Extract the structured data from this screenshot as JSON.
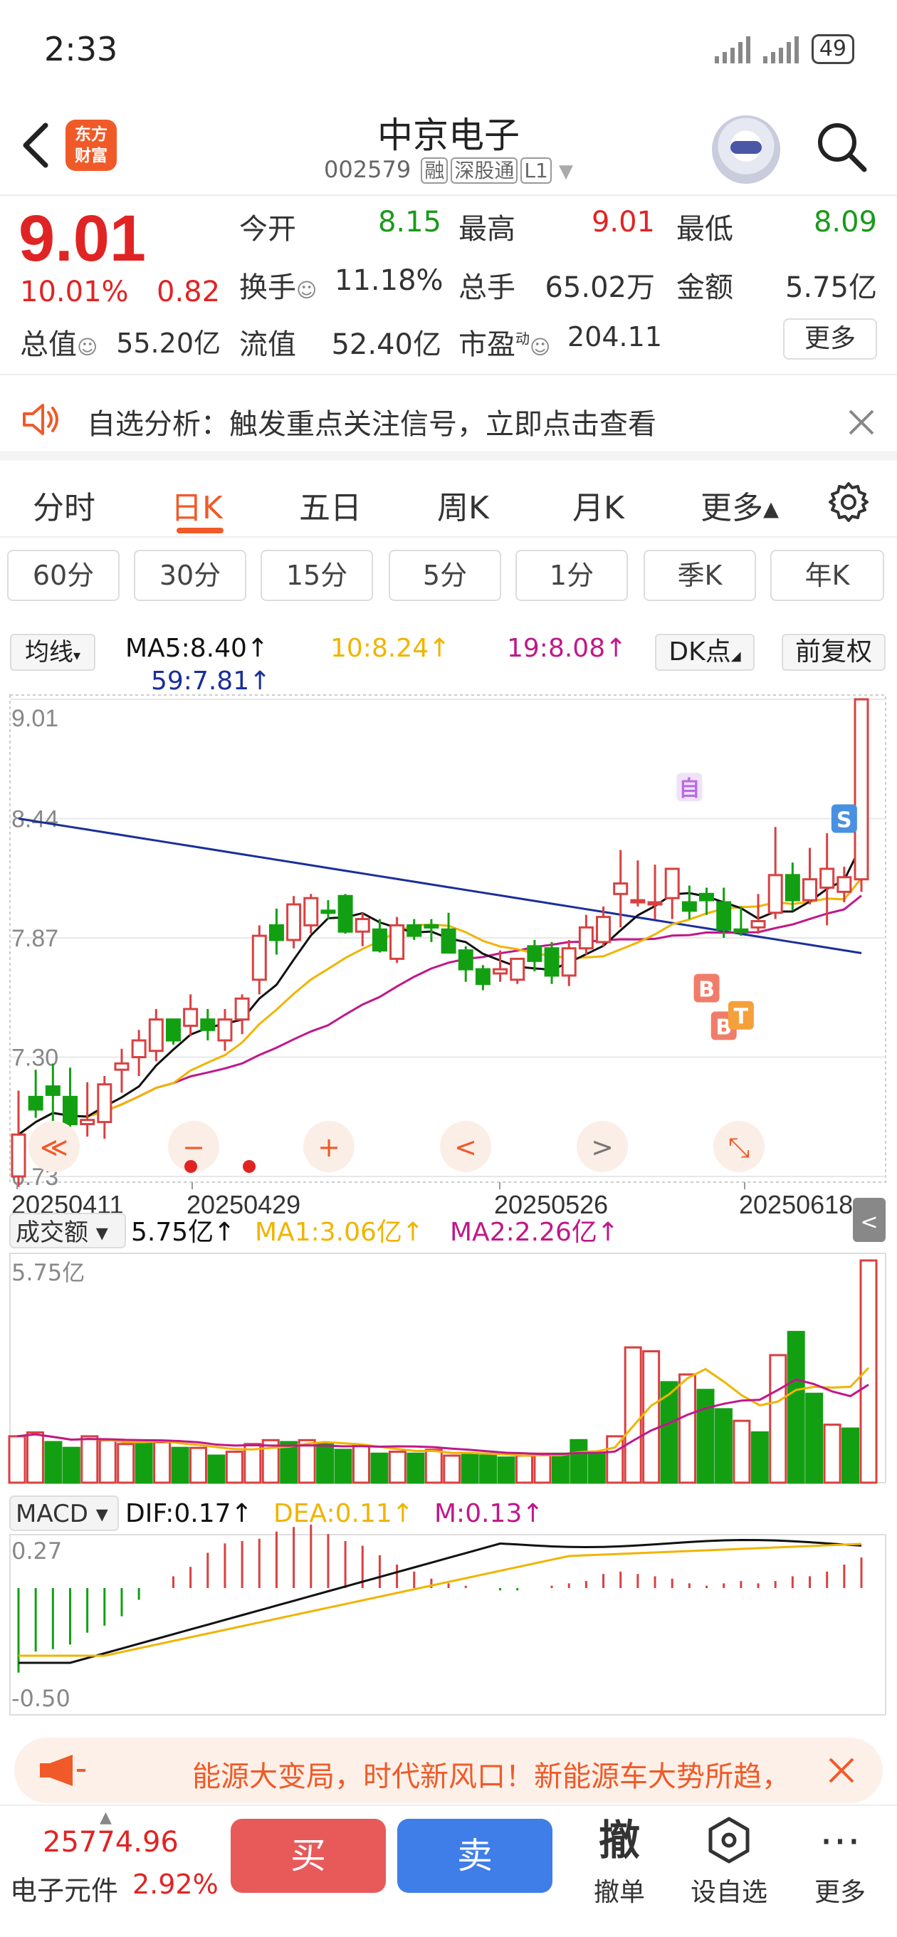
{
  "status": {
    "time": "2:33",
    "battery": "49"
  },
  "header": {
    "logo_text": "东方财富",
    "name": "中京电子",
    "code": "002579",
    "tags": [
      "融",
      "深股通",
      "L1"
    ]
  },
  "quote": {
    "price": "9.01",
    "change_pct": "10.01%",
    "change": "0.82",
    "open_label": "今开",
    "open": "8.15",
    "high_label": "最高",
    "high": "9.01",
    "low_label": "最低",
    "low": "8.09",
    "turnover_label": "换手",
    "turnover": "11.18%",
    "volume_label": "总手",
    "volume": "65.02万",
    "amount_label": "金额",
    "amount": "5.75亿",
    "mktcap_label": "总值",
    "mktcap": "55.20亿",
    "float_label": "流值",
    "float_cap": "52.40亿",
    "pe_label": "市盈",
    "pe_sup": "动",
    "pe": "204.11",
    "more": "更多"
  },
  "notice": {
    "text": "自选分析：触发重点关注信号，立即点击查看"
  },
  "tabs": {
    "items": [
      "分时",
      "日K",
      "五日",
      "周K",
      "月K",
      "更多▴"
    ],
    "active": "日K"
  },
  "periods": [
    "60分",
    "30分",
    "15分",
    "5分",
    "1分",
    "季K",
    "年K"
  ],
  "ma": {
    "select": "均线",
    "ma5": "MA5:8.40↑",
    "ma10": "10:8.24↑",
    "ma19": "19:8.08↑",
    "ma59": "59:7.81↑",
    "dk": "DK点",
    "fuquan": "前复权",
    "colors": {
      "ma5": "#111111",
      "ma10": "#f0b400",
      "ma19": "#c0188a",
      "ma59": "#1a2f9a"
    }
  },
  "chart_data": [
    {
      "type": "candlestick",
      "title": "",
      "y_ticks": [
        "9.01",
        "8.44",
        "7.87",
        "7.30",
        "6.73"
      ],
      "ylim": [
        6.73,
        9.01
      ],
      "x_ticks": [
        "20250411",
        "20250429",
        "20250526",
        "20250618"
      ],
      "markers": [
        "自",
        "S",
        "B",
        "B",
        "T"
      ],
      "candles": [
        {
          "o": 6.73,
          "h": 7.14,
          "l": 6.68,
          "c": 6.93
        },
        {
          "o": 7.11,
          "h": 7.24,
          "l": 7.01,
          "c": 7.05
        },
        {
          "o": 7.16,
          "h": 7.27,
          "l": 6.97,
          "c": 7.12
        },
        {
          "o": 7.11,
          "h": 7.25,
          "l": 6.95,
          "c": 6.98
        },
        {
          "o": 6.98,
          "h": 7.18,
          "l": 6.92,
          "c": 7.0
        },
        {
          "o": 6.99,
          "h": 7.21,
          "l": 6.91,
          "c": 7.17
        },
        {
          "o": 7.24,
          "h": 7.34,
          "l": 7.13,
          "c": 7.27
        },
        {
          "o": 7.3,
          "h": 7.43,
          "l": 7.21,
          "c": 7.38
        },
        {
          "o": 7.33,
          "h": 7.53,
          "l": 7.28,
          "c": 7.48
        },
        {
          "o": 7.48,
          "h": 7.48,
          "l": 7.36,
          "c": 7.38
        },
        {
          "o": 7.45,
          "h": 7.6,
          "l": 7.4,
          "c": 7.53
        },
        {
          "o": 7.48,
          "h": 7.53,
          "l": 7.38,
          "c": 7.43
        },
        {
          "o": 7.38,
          "h": 7.53,
          "l": 7.33,
          "c": 7.48
        },
        {
          "o": 7.48,
          "h": 7.6,
          "l": 7.41,
          "c": 7.58
        },
        {
          "o": 7.67,
          "h": 7.93,
          "l": 7.6,
          "c": 7.88
        },
        {
          "o": 7.93,
          "h": 8.01,
          "l": 7.79,
          "c": 7.86
        },
        {
          "o": 7.86,
          "h": 8.07,
          "l": 7.82,
          "c": 8.03
        },
        {
          "o": 7.93,
          "h": 8.08,
          "l": 7.89,
          "c": 8.06
        },
        {
          "o": 8.0,
          "h": 8.05,
          "l": 7.96,
          "c": 7.99
        },
        {
          "o": 8.07,
          "h": 8.08,
          "l": 7.89,
          "c": 7.9
        },
        {
          "o": 7.9,
          "h": 7.99,
          "l": 7.83,
          "c": 7.96
        },
        {
          "o": 7.91,
          "h": 7.96,
          "l": 7.8,
          "c": 7.81
        },
        {
          "o": 7.77,
          "h": 7.97,
          "l": 7.75,
          "c": 7.93
        },
        {
          "o": 7.93,
          "h": 7.96,
          "l": 7.86,
          "c": 7.88
        },
        {
          "o": 7.93,
          "h": 7.96,
          "l": 7.85,
          "c": 7.92
        },
        {
          "o": 7.91,
          "h": 7.99,
          "l": 7.82,
          "c": 7.8
        },
        {
          "o": 7.81,
          "h": 7.83,
          "l": 7.66,
          "c": 7.72
        },
        {
          "o": 7.72,
          "h": 7.74,
          "l": 7.62,
          "c": 7.65
        },
        {
          "o": 7.7,
          "h": 7.81,
          "l": 7.66,
          "c": 7.72
        },
        {
          "o": 7.67,
          "h": 7.74,
          "l": 7.65,
          "c": 7.77
        },
        {
          "o": 7.83,
          "h": 7.86,
          "l": 7.71,
          "c": 7.76
        },
        {
          "o": 7.82,
          "h": 7.85,
          "l": 7.65,
          "c": 7.69
        },
        {
          "o": 7.69,
          "h": 7.86,
          "l": 7.64,
          "c": 7.82
        },
        {
          "o": 7.82,
          "h": 7.98,
          "l": 7.79,
          "c": 7.92
        },
        {
          "o": 7.85,
          "h": 8.02,
          "l": 7.83,
          "c": 7.97
        },
        {
          "o": 8.08,
          "h": 8.29,
          "l": 7.92,
          "c": 8.13
        },
        {
          "o": 8.05,
          "h": 8.24,
          "l": 8.02,
          "c": 8.05
        },
        {
          "o": 8.04,
          "h": 8.22,
          "l": 7.96,
          "c": 8.04
        },
        {
          "o": 8.06,
          "h": 8.2,
          "l": 7.96,
          "c": 8.2
        },
        {
          "o": 8.04,
          "h": 8.12,
          "l": 7.96,
          "c": 8.0
        },
        {
          "o": 8.08,
          "h": 8.11,
          "l": 7.98,
          "c": 8.05
        },
        {
          "o": 8.04,
          "h": 8.11,
          "l": 7.87,
          "c": 7.91
        },
        {
          "o": 7.91,
          "h": 8.02,
          "l": 7.88,
          "c": 7.9
        },
        {
          "o": 7.92,
          "h": 8.08,
          "l": 7.89,
          "c": 7.95
        },
        {
          "o": 7.99,
          "h": 8.4,
          "l": 7.96,
          "c": 8.17
        },
        {
          "o": 8.17,
          "h": 8.23,
          "l": 8.0,
          "c": 8.05
        },
        {
          "o": 8.05,
          "h": 8.3,
          "l": 8.03,
          "c": 8.15
        },
        {
          "o": 8.11,
          "h": 8.37,
          "l": 7.93,
          "c": 8.2
        },
        {
          "o": 8.09,
          "h": 8.21,
          "l": 8.04,
          "c": 8.16
        },
        {
          "o": 8.15,
          "h": 9.01,
          "l": 8.09,
          "c": 9.01
        }
      ]
    },
    {
      "type": "bar",
      "title": "成交额",
      "value_label": "5.75亿↑",
      "ma1": "MA1:3.06亿↑",
      "ma2": "MA2:2.26亿↑",
      "ylim_label": "5.75亿",
      "values": [
        1.2,
        1.3,
        1.05,
        0.9,
        1.2,
        1.1,
        1.0,
        1.05,
        1.05,
        0.9,
        0.9,
        0.7,
        0.8,
        1.0,
        1.1,
        1.05,
        1.1,
        1.0,
        0.85,
        0.95,
        0.75,
        0.8,
        0.75,
        0.85,
        0.7,
        0.75,
        0.7,
        0.65,
        0.7,
        0.75,
        0.75,
        1.1,
        0.75,
        1.2,
        3.5,
        3.4,
        2.6,
        2.8,
        2.4,
        1.9,
        1.6,
        1.3,
        3.3,
        3.9,
        2.3,
        1.5,
        1.4,
        5.75
      ],
      "up": [
        true,
        true,
        false,
        false,
        true,
        true,
        true,
        false,
        true,
        false,
        true,
        false,
        true,
        true,
        true,
        false,
        true,
        false,
        false,
        true,
        false,
        true,
        false,
        true,
        true,
        false,
        false,
        false,
        true,
        true,
        false,
        false,
        false,
        true,
        true,
        true,
        false,
        true,
        false,
        false,
        true,
        false,
        true,
        false,
        false,
        true,
        false,
        true
      ]
    },
    {
      "type": "bar",
      "title": "MACD",
      "dif": "DIF:0.17↑",
      "dea": "DEA:0.11↑",
      "m": "M:0.13↑",
      "y_ticks": [
        "0.27",
        "-0.50"
      ],
      "values": [
        -0.36,
        -0.27,
        -0.26,
        -0.24,
        -0.19,
        -0.16,
        -0.12,
        -0.05,
        0.0,
        0.05,
        0.09,
        0.15,
        0.19,
        0.2,
        0.21,
        0.24,
        0.26,
        0.27,
        0.23,
        0.2,
        0.18,
        0.14,
        0.1,
        0.07,
        0.04,
        0.02,
        0.01,
        0.0,
        -0.01,
        -0.01,
        0.0,
        0.01,
        0.02,
        0.03,
        0.06,
        0.07,
        0.06,
        0.05,
        0.04,
        0.02,
        0.01,
        0.02,
        0.03,
        0.02,
        0.03,
        0.05,
        0.05,
        0.07,
        0.1,
        0.13
      ]
    }
  ],
  "chart_controls": [
    "≪",
    "−",
    "+",
    "<",
    ">",
    "⤡"
  ],
  "ad": {
    "text": "能源大变局，时代新风口！新能源车大势所趋，"
  },
  "bottom": {
    "index_value": "25774.96",
    "index_name": "电子元件",
    "index_pct": "2.92%",
    "buy": "买",
    "sell": "卖",
    "cancel_icon": "撤",
    "cancel": "撤单",
    "watch": "设自选",
    "more": "更多"
  }
}
